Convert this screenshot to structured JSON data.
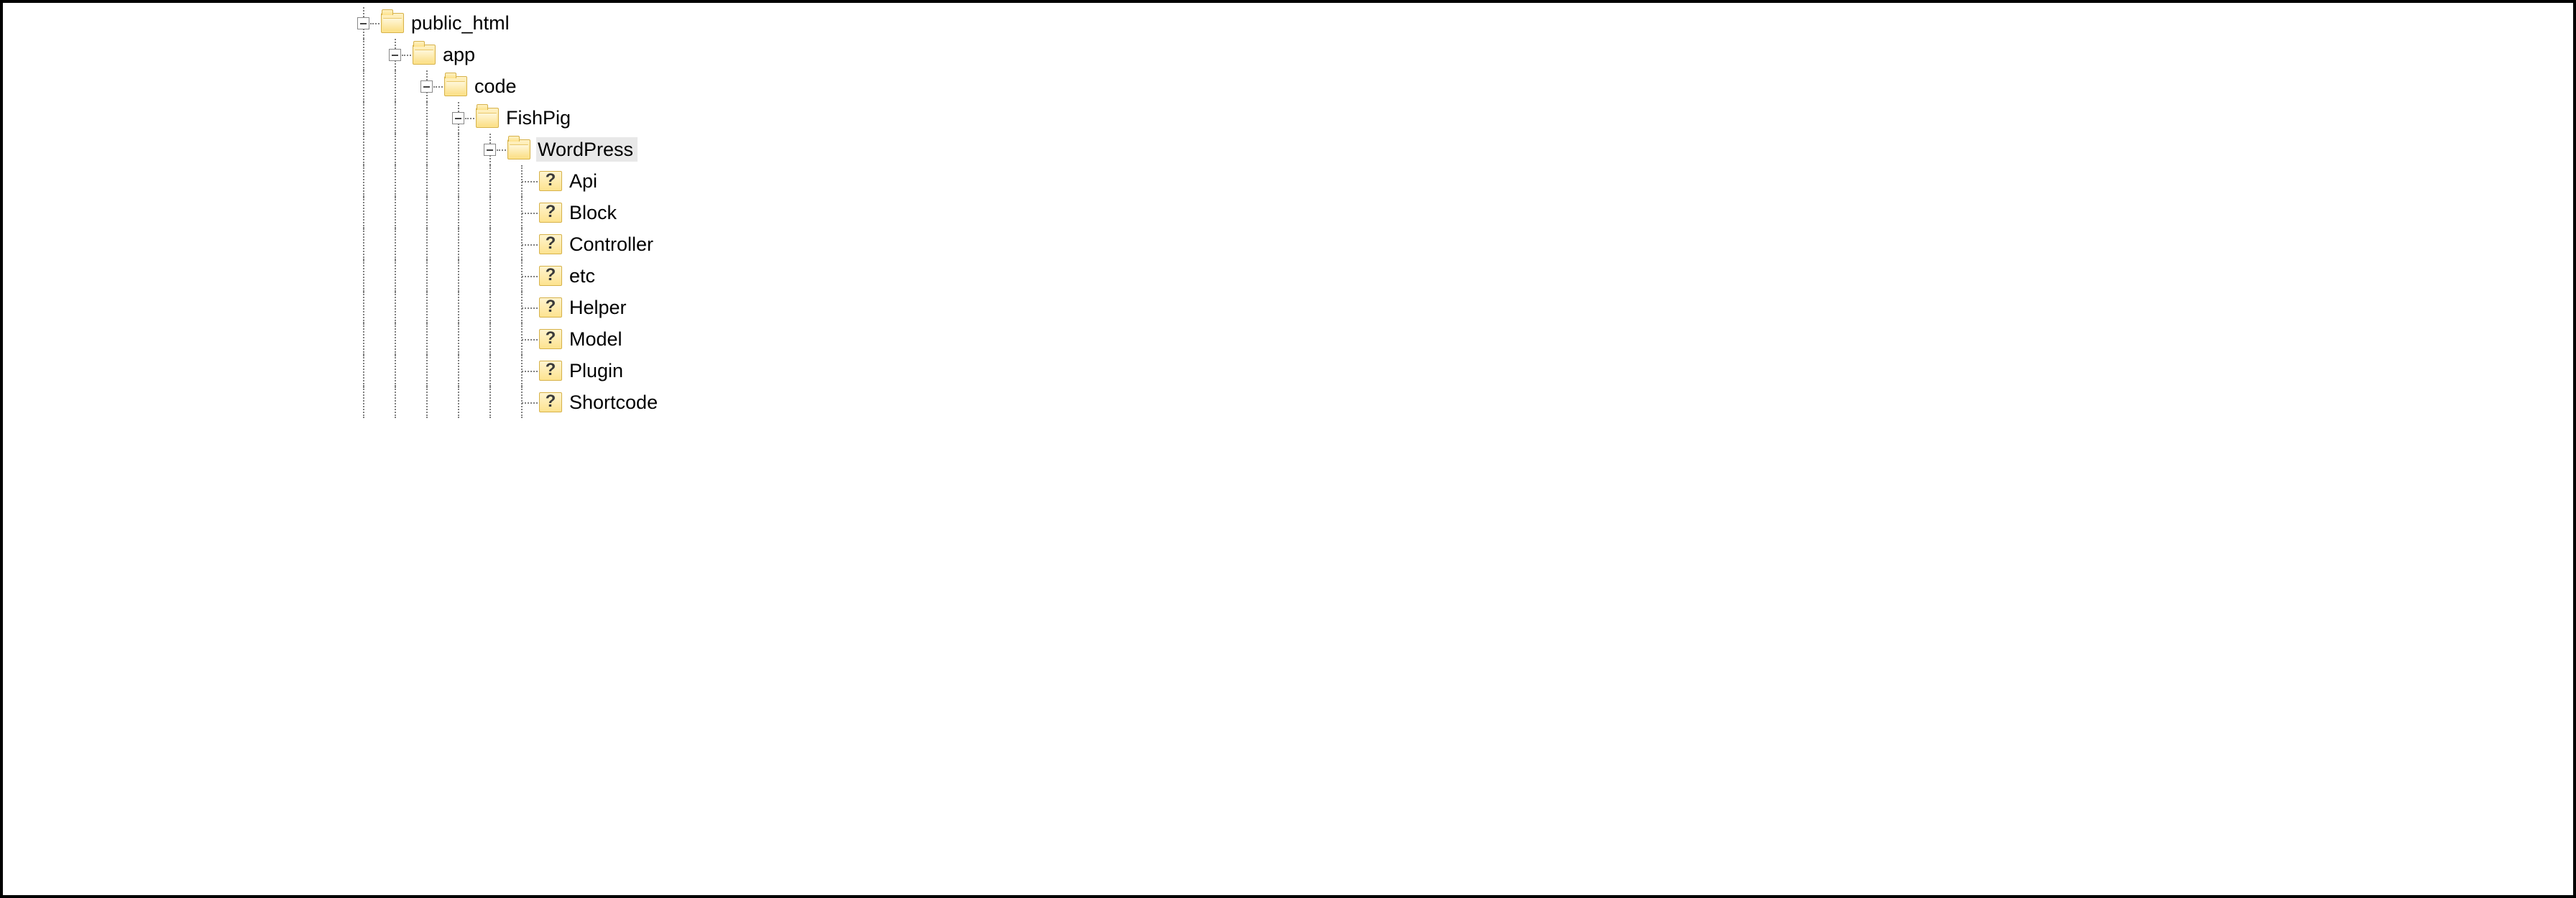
{
  "tree": {
    "public_html": "public_html",
    "app": "app",
    "code": "code",
    "fishpig": "FishPig",
    "wordpress": "WordPress",
    "children": [
      "Api",
      "Block",
      "Controller",
      "etc",
      "Helper",
      "Model",
      "Plugin",
      "Shortcode"
    ]
  },
  "selected": "WordPress"
}
